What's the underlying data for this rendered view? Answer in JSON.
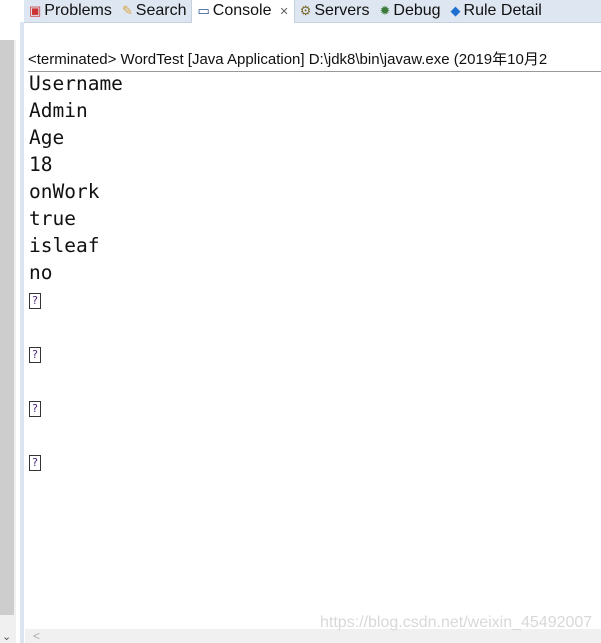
{
  "tabs": [
    {
      "label": "Problems",
      "icon": "problems-icon"
    },
    {
      "label": "Search",
      "icon": "search-icon"
    },
    {
      "label": "Console",
      "icon": "console-icon",
      "active": true
    },
    {
      "label": "Servers",
      "icon": "servers-icon"
    },
    {
      "label": "Debug",
      "icon": "debug-icon"
    },
    {
      "label": "Rule Detail",
      "icon": "rule-detail-icon"
    }
  ],
  "console": {
    "header": "<terminated> WordTest [Java Application] D:\\jdk8\\bin\\javaw.exe (2019年10月2",
    "lines": [
      "Username",
      "Admin",
      "Age",
      "18",
      "onWork",
      "true",
      "isleaf",
      "no"
    ],
    "unknown_glyph": "?"
  },
  "watermark": "https://blog.csdn.net/weixin_45492007"
}
